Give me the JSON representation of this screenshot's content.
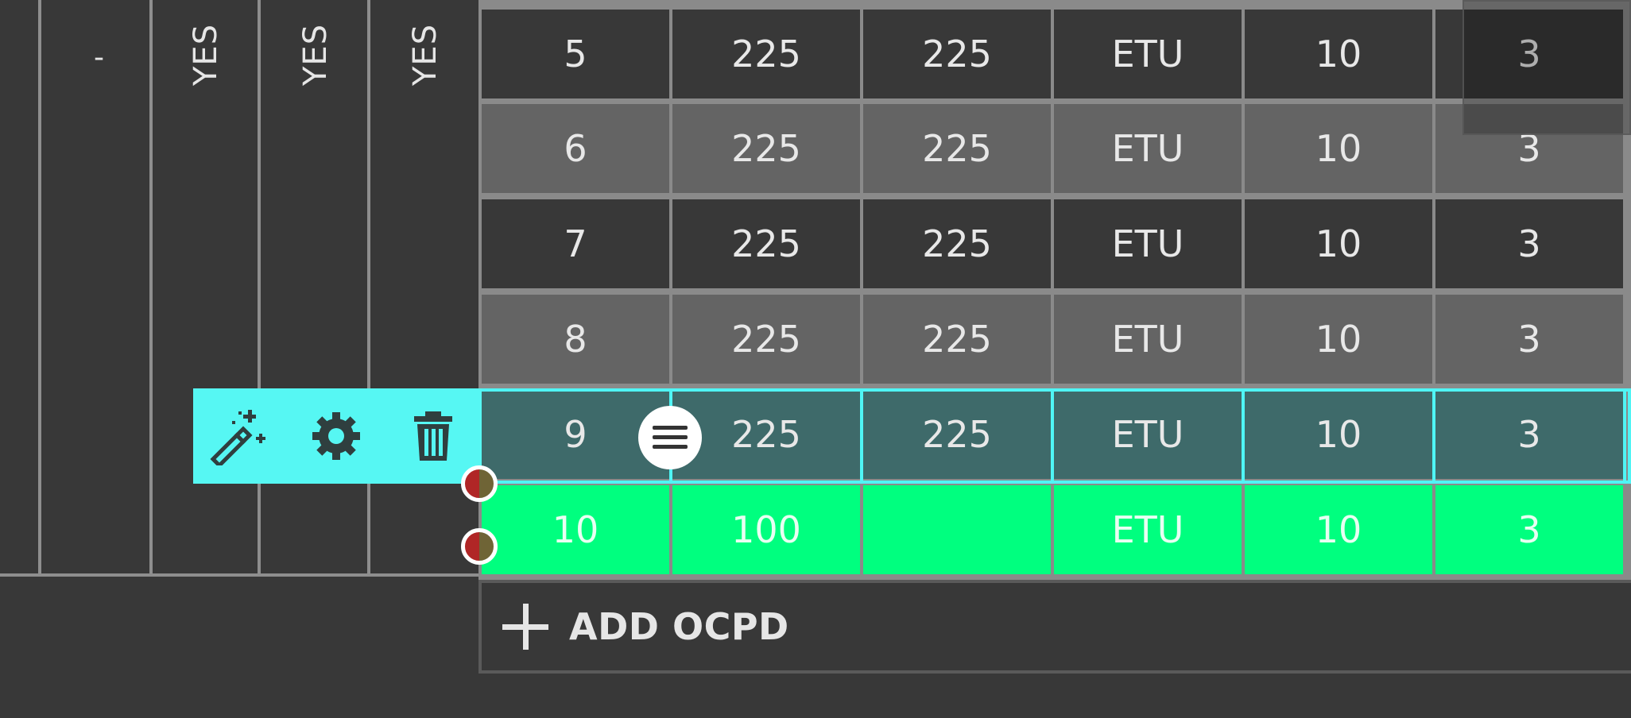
{
  "left_columns": {
    "col1_value": "-",
    "col2_value": "YES",
    "col3_value": "YES",
    "col4_value": "YES"
  },
  "table": {
    "rows": [
      {
        "cells": [
          "5",
          "225",
          "225",
          "ETU",
          "10",
          "3"
        ]
      },
      {
        "cells": [
          "6",
          "225",
          "225",
          "ETU",
          "10",
          "3"
        ]
      },
      {
        "cells": [
          "7",
          "225",
          "225",
          "ETU",
          "10",
          "3"
        ]
      },
      {
        "cells": [
          "8",
          "225",
          "225",
          "ETU",
          "10",
          "3"
        ]
      },
      {
        "cells": [
          "9",
          "225",
          "225",
          "ETU",
          "10",
          "3"
        ]
      },
      {
        "cells": [
          "10",
          "100",
          "",
          "ETU",
          "10",
          "3"
        ]
      }
    ]
  },
  "toolbar": {
    "icons": [
      "magic-wand-icon",
      "gear-icon",
      "trash-icon"
    ]
  },
  "row_menu": {
    "icon": "hamburger-menu-icon"
  },
  "add_button": {
    "label": "ADD OCPD",
    "icon": "plus-icon"
  },
  "colors": {
    "background": "#383838",
    "row_light": "#646464",
    "selected_row": "#3e6a6a",
    "accent_cyan": "#56f7f3",
    "new_row_green": "#00ff7f"
  }
}
